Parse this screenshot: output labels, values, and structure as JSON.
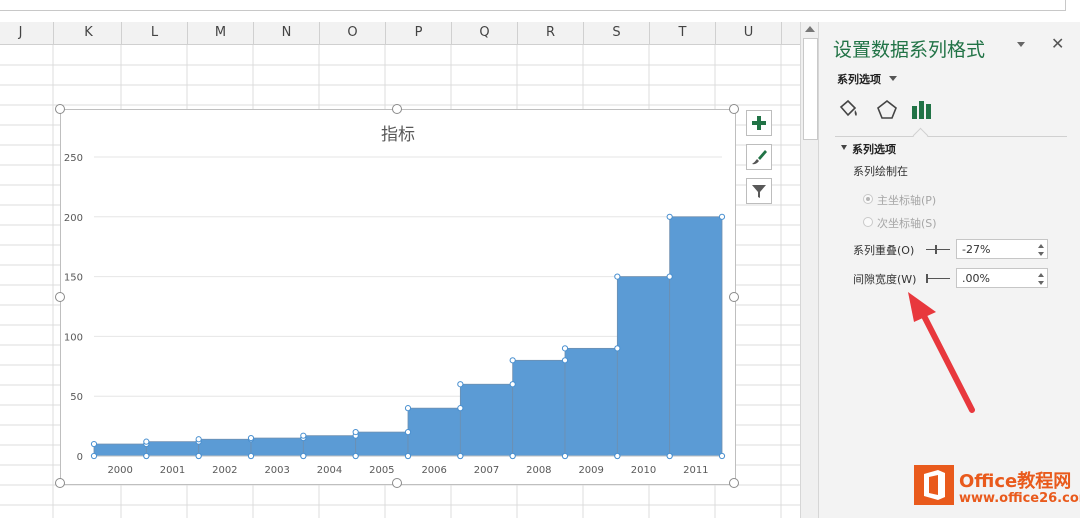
{
  "spreadsheet": {
    "columns": [
      "J",
      "K",
      "L",
      "M",
      "N",
      "O",
      "P",
      "Q",
      "R",
      "S",
      "T",
      "U"
    ]
  },
  "chart_data": {
    "type": "bar",
    "title": "指标",
    "categories": [
      "2000",
      "2001",
      "2002",
      "2003",
      "2004",
      "2005",
      "2006",
      "2007",
      "2008",
      "2009",
      "2010",
      "2011"
    ],
    "values": [
      10,
      12,
      14,
      15,
      17,
      20,
      40,
      60,
      80,
      90,
      150,
      200
    ],
    "ylim": [
      0,
      250
    ],
    "yticks": [
      0,
      50,
      100,
      150,
      200,
      250
    ],
    "grid": true,
    "bar_color": "#5b9bd5",
    "legend": "none"
  },
  "chart_buttons": {
    "elements": "plus-icon",
    "styles": "brush-icon",
    "filters": "funnel-icon"
  },
  "pane": {
    "title": "设置数据系列格式",
    "series_dropdown": "系列选项",
    "tabs": [
      "fill-line-icon",
      "effects-pentagon-icon",
      "series-options-bars-icon"
    ],
    "section_title": "系列选项",
    "plot_on_label": "系列绘制在",
    "primary_axis": "主坐标轴(P)",
    "secondary_axis": "次坐标轴(S)",
    "overlap_label": "系列重叠(O)",
    "overlap_value": "-27%",
    "gap_label": "间隙宽度(W)",
    "gap_value": ".00%",
    "accent_color": "#217346"
  },
  "watermark": {
    "line1": "Office教程网",
    "line2": "www.office26.com"
  }
}
